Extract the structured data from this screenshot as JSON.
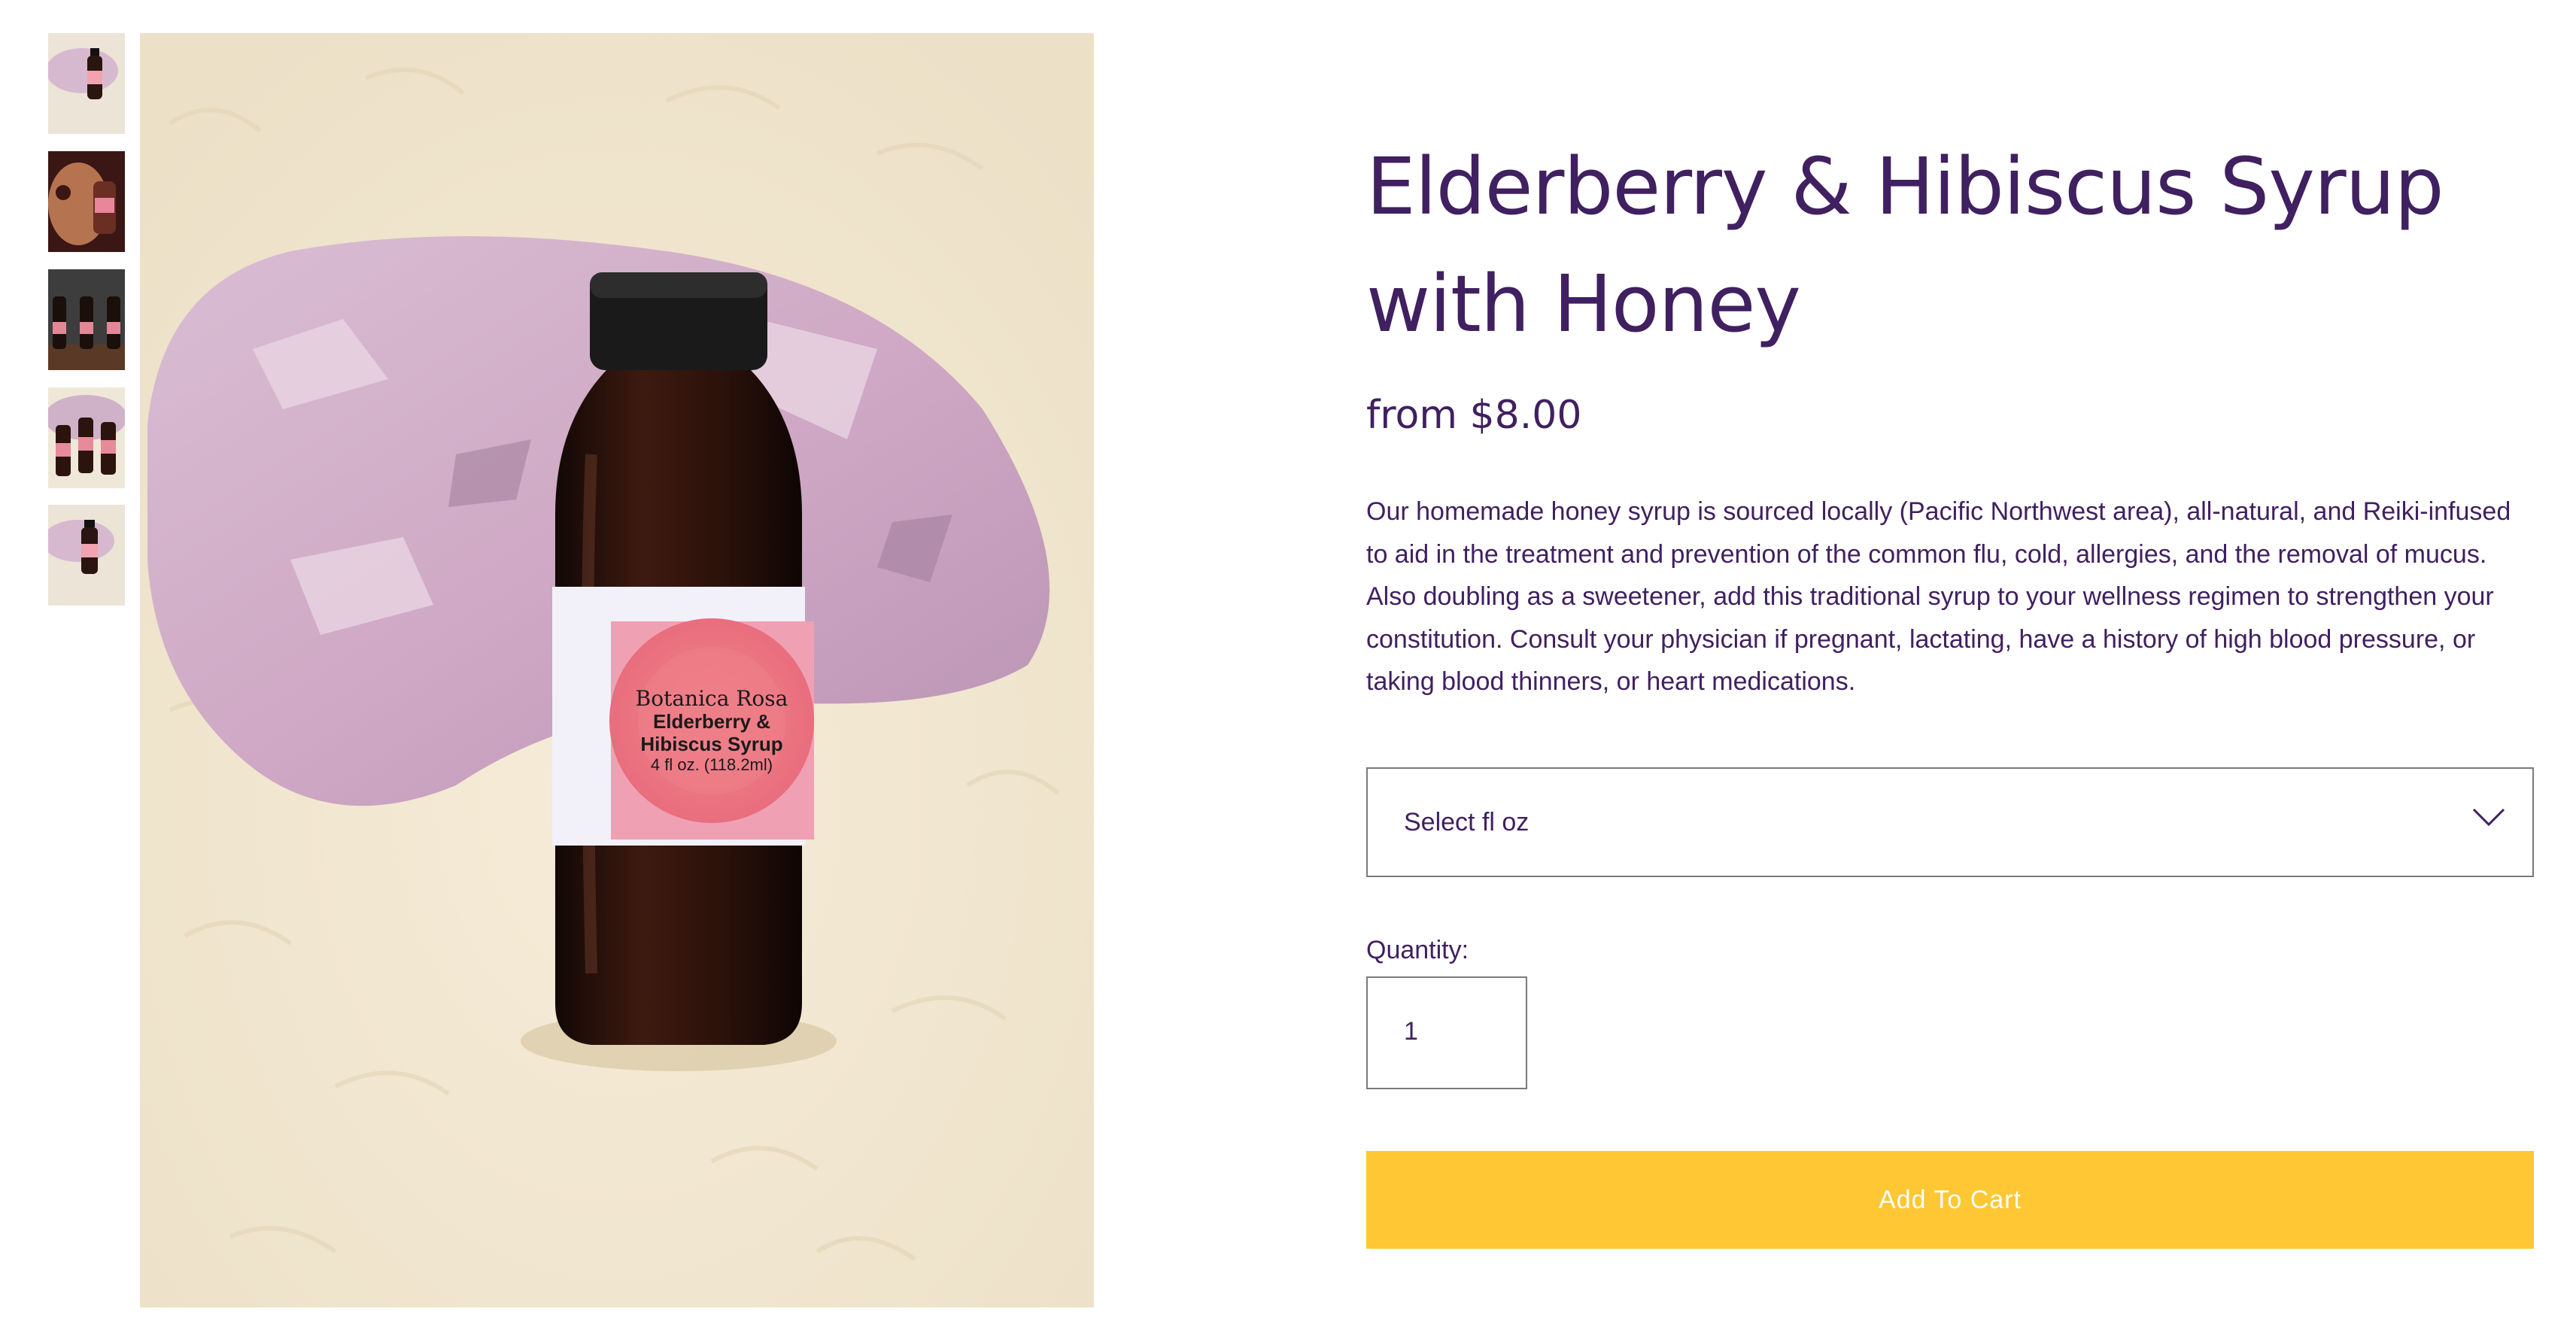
{
  "product": {
    "title": "Elderberry & Hibiscus Syrup with Honey",
    "price": "from $8.00",
    "description": "Our homemade honey syrup is sourced locally (Pacific Northwest area), all-natural, and Reiki-infused to aid in the treatment and prevention of the common flu, cold, allergies, and the removal of mucus.  Also doubling as a sweetener, add this traditional syrup to your wellness regimen to strengthen your constitution. Consult your physician if pregnant, lactating,  have a history of high blood pressure, or taking blood thinners, or heart medications."
  },
  "size_select": {
    "placeholder": "Select fl oz",
    "icon": "chevron-down-icon"
  },
  "quantity": {
    "label": "Quantity:",
    "value": "1"
  },
  "cart": {
    "button_label": "Add To Cart"
  },
  "label_on_bottle": {
    "brand": "Botanica Rosa",
    "line1": "Elderberry &",
    "line2": "Hibiscus Syrup",
    "line3": "4 fl oz. (118.2ml)"
  },
  "colors": {
    "title": "#402060",
    "button": "#ffc734",
    "button_text": "#ffffff",
    "border": "#7a7a7a"
  }
}
